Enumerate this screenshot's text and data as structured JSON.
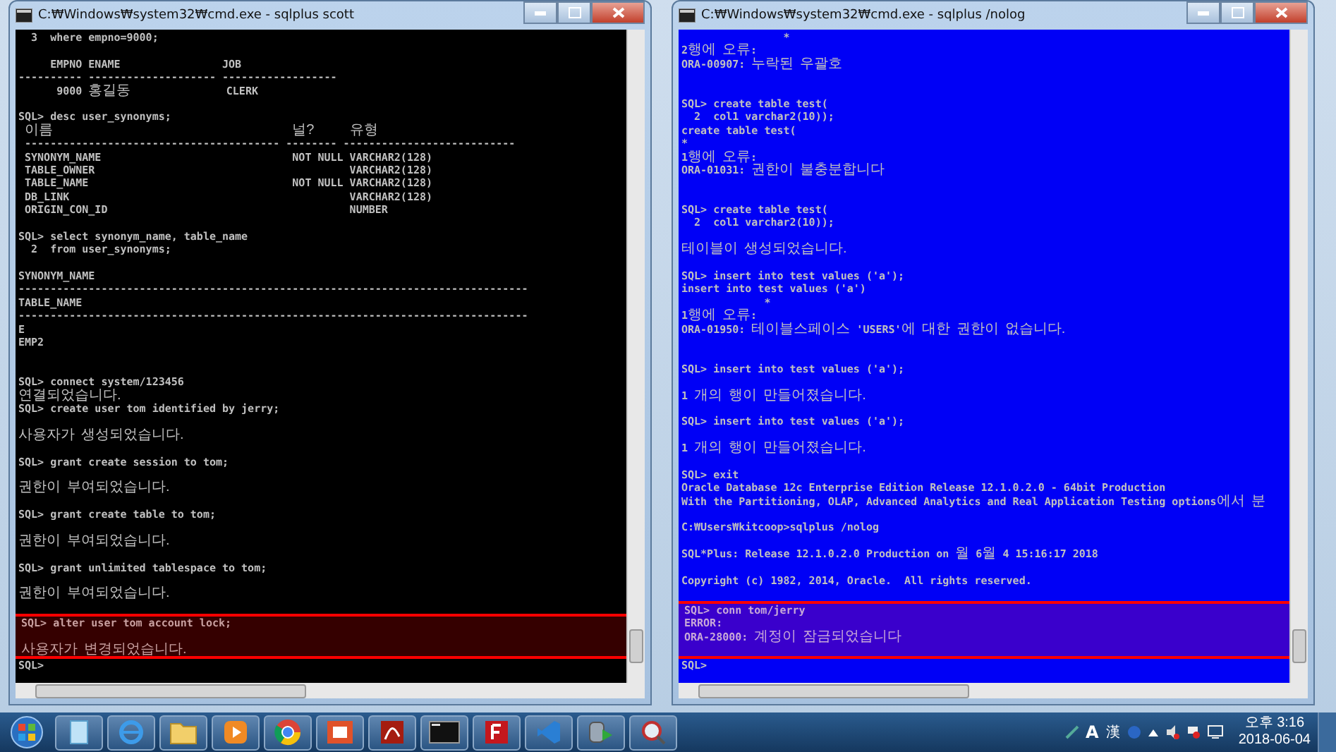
{
  "windows": [
    {
      "title": "C:₩Windows₩system32₩cmd.exe - sqlplus  scott",
      "color": "#000000",
      "lines": [
        {
          "kind": "text",
          "text": "  3  where empno=9000;"
        },
        {
          "kind": "blank"
        },
        {
          "kind": "text",
          "text": "     EMPNO ENAME                JOB"
        },
        {
          "kind": "text",
          "text": "---------- -------------------- ------------------"
        },
        {
          "kind": "text",
          "text": "      9000 홍길동               CLERK"
        },
        {
          "kind": "blank"
        },
        {
          "kind": "text",
          "text": "SQL> desc user_synonyms;"
        },
        {
          "kind": "columns",
          "cells": [
            "이름",
            "널?",
            "유형"
          ]
        },
        {
          "kind": "text",
          "text": " ---------------------------------------- -------- ---------------------------"
        },
        {
          "kind": "text",
          "text": " SYNONYM_NAME                              NOT NULL VARCHAR2(128)"
        },
        {
          "kind": "text",
          "text": " TABLE_OWNER                                        VARCHAR2(128)"
        },
        {
          "kind": "text",
          "text": " TABLE_NAME                                NOT NULL VARCHAR2(128)"
        },
        {
          "kind": "text",
          "text": " DB_LINK                                            VARCHAR2(128)"
        },
        {
          "kind": "text",
          "text": " ORIGIN_CON_ID                                      NUMBER"
        },
        {
          "kind": "blank"
        },
        {
          "kind": "text",
          "text": "SQL> select synonym_name, table_name"
        },
        {
          "kind": "text",
          "text": "  2  from user_synonyms;"
        },
        {
          "kind": "blank"
        },
        {
          "kind": "text",
          "text": "SYNONYM_NAME"
        },
        {
          "kind": "text",
          "text": "--------------------------------------------------------------------------------"
        },
        {
          "kind": "text",
          "text": "TABLE_NAME"
        },
        {
          "kind": "text",
          "text": "--------------------------------------------------------------------------------"
        },
        {
          "kind": "text",
          "text": "E"
        },
        {
          "kind": "text",
          "text": "EMP2"
        },
        {
          "kind": "blank"
        },
        {
          "kind": "blank"
        },
        {
          "kind": "text",
          "text": "SQL> connect system/123456"
        },
        {
          "kind": "text",
          "text": "연결되었습니다."
        },
        {
          "kind": "text",
          "text": "SQL> create user tom identified by jerry;"
        },
        {
          "kind": "blank"
        },
        {
          "kind": "text",
          "text": "사용자가 생성되었습니다."
        },
        {
          "kind": "blank"
        },
        {
          "kind": "text",
          "text": "SQL> grant create session to tom;"
        },
        {
          "kind": "blank"
        },
        {
          "kind": "text",
          "text": "권한이 부여되었습니다."
        },
        {
          "kind": "blank"
        },
        {
          "kind": "text",
          "text": "SQL> grant create table to tom;"
        },
        {
          "kind": "blank"
        },
        {
          "kind": "text",
          "text": "권한이 부여되었습니다."
        },
        {
          "kind": "blank"
        },
        {
          "kind": "text",
          "text": "SQL> grant unlimited tablespace to tom;"
        },
        {
          "kind": "blank"
        },
        {
          "kind": "text",
          "text": "권한이 부여되었습니다."
        },
        {
          "kind": "blank"
        }
      ],
      "marked_lines": [
        {
          "kind": "text",
          "text": "SQL> alter user tom account lock;"
        },
        {
          "kind": "blank"
        },
        {
          "kind": "text",
          "text": "사용자가 변경되었습니다."
        }
      ],
      "trailing_lines": [
        {
          "kind": "text",
          "text": "SQL>"
        }
      ]
    },
    {
      "title": "C:₩Windows₩system32₩cmd.exe - sqlplus  /nolog",
      "color": "#0000f6",
      "lines": [
        {
          "kind": "text",
          "text": "                *"
        },
        {
          "kind": "text",
          "text": "2행에 오류:"
        },
        {
          "kind": "text",
          "text": "ORA-00907: 누락된 우괄호"
        },
        {
          "kind": "blank"
        },
        {
          "kind": "blank"
        },
        {
          "kind": "text",
          "text": "SQL> create table test("
        },
        {
          "kind": "text",
          "text": "  2  col1 varchar2(10));"
        },
        {
          "kind": "text",
          "text": "create table test("
        },
        {
          "kind": "text",
          "text": "*"
        },
        {
          "kind": "text",
          "text": "1행에 오류:"
        },
        {
          "kind": "text",
          "text": "ORA-01031: 권한이 불충분합니다"
        },
        {
          "kind": "blank"
        },
        {
          "kind": "blank"
        },
        {
          "kind": "text",
          "text": "SQL> create table test("
        },
        {
          "kind": "text",
          "text": "  2  col1 varchar2(10));"
        },
        {
          "kind": "blank"
        },
        {
          "kind": "text",
          "text": "테이블이 생성되었습니다."
        },
        {
          "kind": "blank"
        },
        {
          "kind": "text",
          "text": "SQL> insert into test values ('a');"
        },
        {
          "kind": "text",
          "text": "insert into test values ('a')"
        },
        {
          "kind": "text",
          "text": "             *"
        },
        {
          "kind": "text",
          "text": "1행에 오류:"
        },
        {
          "kind": "text",
          "text": "ORA-01950: 테이블스페이스 'USERS'에 대한 권한이 없습니다."
        },
        {
          "kind": "blank"
        },
        {
          "kind": "blank"
        },
        {
          "kind": "text",
          "text": "SQL> insert into test values ('a');"
        },
        {
          "kind": "blank"
        },
        {
          "kind": "text",
          "text": "1 개의 행이 만들어졌습니다."
        },
        {
          "kind": "blank"
        },
        {
          "kind": "text",
          "text": "SQL> insert into test values ('a');"
        },
        {
          "kind": "blank"
        },
        {
          "kind": "text",
          "text": "1 개의 행이 만들어졌습니다."
        },
        {
          "kind": "blank"
        },
        {
          "kind": "text",
          "text": "SQL> exit"
        },
        {
          "kind": "text",
          "text": "Oracle Database 12c Enterprise Edition Release 12.1.0.2.0 - 64bit Production"
        },
        {
          "kind": "text",
          "text": "With the Partitioning, OLAP, Advanced Analytics and Real Application Testing options에서 분"
        },
        {
          "kind": "blank"
        },
        {
          "kind": "text",
          "text": "C:₩Users₩kitcoop>sqlplus /nolog"
        },
        {
          "kind": "blank"
        },
        {
          "kind": "text",
          "text": "SQL*Plus: Release 12.1.0.2.0 Production on 월 6월 4 15:16:17 2018"
        },
        {
          "kind": "blank"
        },
        {
          "kind": "text",
          "text": "Copyright (c) 1982, 2014, Oracle.  All rights reserved."
        },
        {
          "kind": "blank"
        }
      ],
      "marked_lines": [
        {
          "kind": "text",
          "text": "SQL> conn tom/jerry"
        },
        {
          "kind": "text",
          "text": "ERROR:"
        },
        {
          "kind": "text",
          "text": "ORA-28000: 계정이 잠금되었습니다"
        },
        {
          "kind": "blank"
        }
      ],
      "trailing_lines": [
        {
          "kind": "text",
          "text": "SQL>"
        }
      ]
    }
  ],
  "taskbar": {
    "language": "A",
    "ime": "漢",
    "time": "오후 3:16",
    "date": "2018-06-04"
  }
}
